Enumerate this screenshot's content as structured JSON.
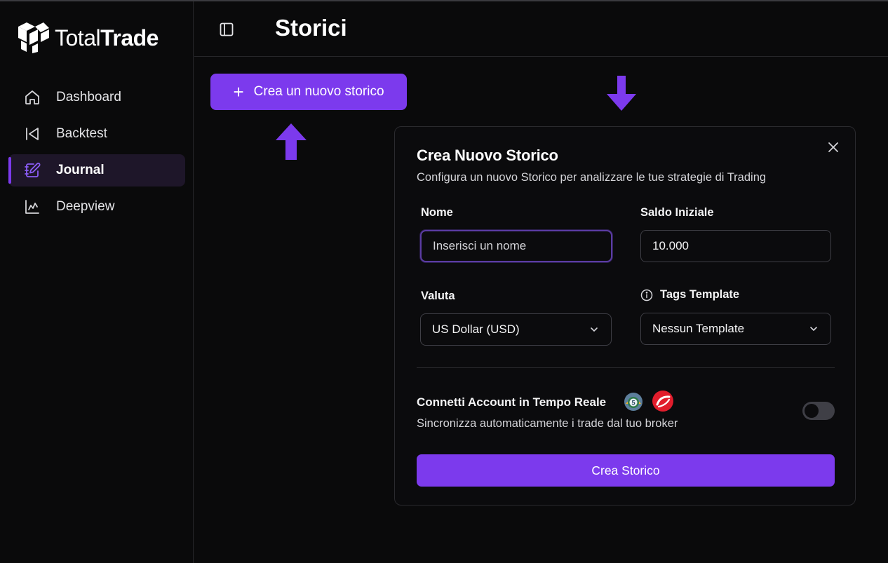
{
  "app": {
    "brand_light": "Total",
    "brand_bold": "Trade",
    "logo_icon": "totaltrade-logo-icon"
  },
  "sidebar": {
    "items": [
      {
        "label": "Dashboard",
        "icon": "home-icon",
        "active": false
      },
      {
        "label": "Backtest",
        "icon": "skip-back-icon",
        "active": false
      },
      {
        "label": "Journal",
        "icon": "notebook-pen-icon",
        "active": true
      },
      {
        "label": "Deepview",
        "icon": "chart-icon",
        "active": false
      }
    ]
  },
  "header": {
    "title": "Storici",
    "toggle_icon": "panel-left-icon"
  },
  "create_button": {
    "icon": "plus-icon",
    "label": "Crea un nuovo storico"
  },
  "modal": {
    "title": "Crea Nuovo Storico",
    "description": "Configura un nuovo Storico per analizzare le tue strategie di Trading",
    "close_icon": "close-icon",
    "fields": {
      "name": {
        "label": "Nome",
        "placeholder": "Inserisci un nome",
        "value": ""
      },
      "balance": {
        "label": "Saldo Iniziale",
        "value": "10.000"
      },
      "currency": {
        "label": "Valuta",
        "selected": "US Dollar (USD)"
      },
      "tags": {
        "label": "Tags Template",
        "selected": "Nessun Template",
        "info_icon": "info-icon"
      }
    },
    "connect": {
      "title": "Connetti Account in Tempo Reale",
      "description": "Sincronizza automaticamente i trade dal tuo broker",
      "toggle_on": false,
      "broker_icons": [
        "metatrader-icon",
        "ctrader-icon"
      ]
    },
    "submit_label": "Crea Storico"
  },
  "colors": {
    "accent": "#7c3aed",
    "background": "#0a0a0b",
    "active_nav_bg": "#1e1629",
    "border": "#27272a"
  }
}
